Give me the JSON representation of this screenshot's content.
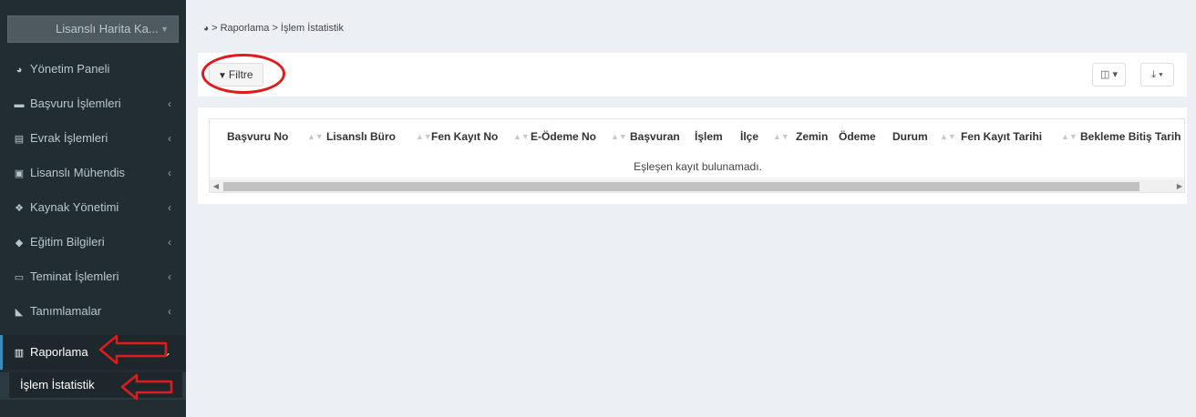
{
  "sidebar": {
    "org_select": "Lisanslı Harita Ka...",
    "items": [
      {
        "label": "Yönetim Paneli",
        "icon": "dashboard-icon"
      },
      {
        "label": "Başvuru İşlemleri",
        "icon": "briefcase-icon"
      },
      {
        "label": "Evrak İşlemleri",
        "icon": "document-icon"
      },
      {
        "label": "Lisanslı Mühendis",
        "icon": "id-card-icon"
      },
      {
        "label": "Kaynak Yönetimi",
        "icon": "cubes-icon"
      },
      {
        "label": "Eğitim Bilgileri",
        "icon": "graduation-cap-icon"
      },
      {
        "label": "Teminat İşlemleri",
        "icon": "money-icon"
      },
      {
        "label": "Tanımlamalar",
        "icon": "tag-icon"
      },
      {
        "label": "Raporlama",
        "icon": "bar-chart-icon"
      }
    ],
    "submenu": {
      "label": "İşlem İstatistik"
    }
  },
  "breadcrumb": {
    "text": "> Raporlama > İşlem İstatistik"
  },
  "toolbar": {
    "filter_label": "Filtre"
  },
  "table": {
    "columns": [
      "Başvuru No",
      "Lisanslı Büro",
      "Fen Kayıt No",
      "E-Ödeme No",
      "Başvuran",
      "İşlem",
      "İlçe",
      "Zemin",
      "Ödeme",
      "Durum",
      "Fen Kayıt Tarihi",
      "Bekleme Bitiş Tarih"
    ],
    "empty_message": "Eşleşen kayıt bulunamadı."
  },
  "colors": {
    "sidebar_bg": "#222d32",
    "accent": "#3c8dbc",
    "annotation": "#e01b1b"
  }
}
